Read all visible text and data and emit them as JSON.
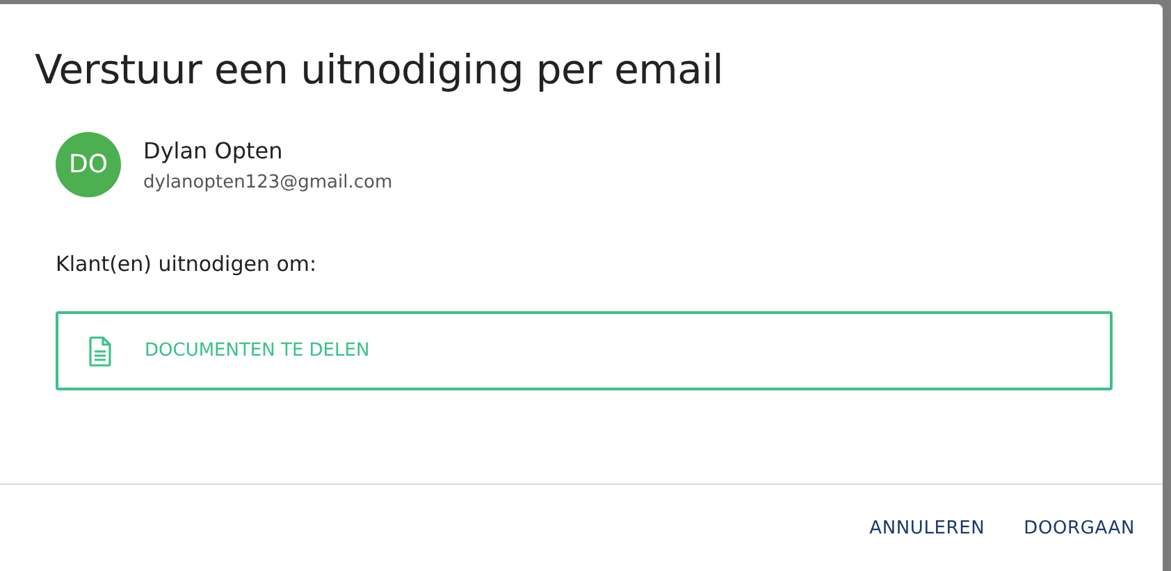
{
  "dialog": {
    "title": "Verstuur een uitnodiging per email",
    "contact": {
      "initials": "DO",
      "name": "Dylan Opten",
      "email": "dylanopten123@gmail.com"
    },
    "prompt": "Klant(en) uitnodigen om:",
    "options": [
      {
        "label": "DOCUMENTEN TE DELEN"
      }
    ],
    "buttons": [
      "ANNULEREN",
      "DOORGAAN"
    ]
  }
}
